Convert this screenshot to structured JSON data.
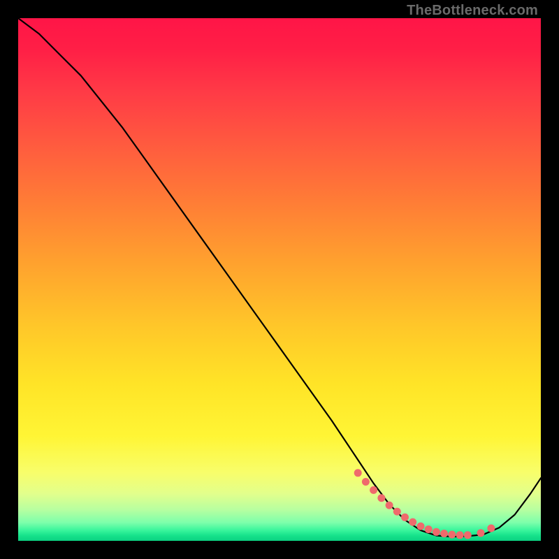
{
  "watermark": "TheBottleneck.com",
  "chart_data": {
    "type": "line",
    "title": "",
    "xlabel": "",
    "ylabel": "",
    "xlim": [
      0,
      100
    ],
    "ylim": [
      0,
      100
    ],
    "grid": false,
    "legend": false,
    "series": [
      {
        "name": "bottleneck-curve",
        "x": [
          0,
          4,
          8,
          12,
          16,
          20,
          25,
          30,
          35,
          40,
          45,
          50,
          55,
          60,
          64,
          68,
          71,
          74,
          77,
          80,
          83,
          86,
          89,
          92,
          95,
          98,
          100
        ],
        "y": [
          100,
          97,
          93,
          89,
          84,
          79,
          72,
          65,
          58,
          51,
          44,
          37,
          30,
          23,
          17,
          11,
          7,
          4,
          2,
          1,
          0.8,
          0.9,
          1.2,
          2.5,
          5,
          9,
          12
        ]
      }
    ],
    "highlight_points": {
      "name": "optimal-region-dots",
      "x": [
        65,
        66.5,
        68,
        69.5,
        71,
        72.5,
        74,
        75.5,
        77,
        78.5,
        80,
        81.5,
        83,
        84.5,
        86,
        88.5,
        90.5
      ],
      "y": [
        13,
        11.3,
        9.7,
        8.2,
        6.8,
        5.6,
        4.5,
        3.6,
        2.8,
        2.2,
        1.7,
        1.4,
        1.2,
        1.1,
        1.1,
        1.5,
        2.4
      ]
    },
    "background_gradient": {
      "orientation": "vertical",
      "stops": [
        {
          "pos": 0.0,
          "color": "#ff1547"
        },
        {
          "pos": 0.35,
          "color": "#ff7c36"
        },
        {
          "pos": 0.7,
          "color": "#ffe427"
        },
        {
          "pos": 0.92,
          "color": "#d0ff96"
        },
        {
          "pos": 1.0,
          "color": "#0bd181"
        }
      ]
    }
  }
}
